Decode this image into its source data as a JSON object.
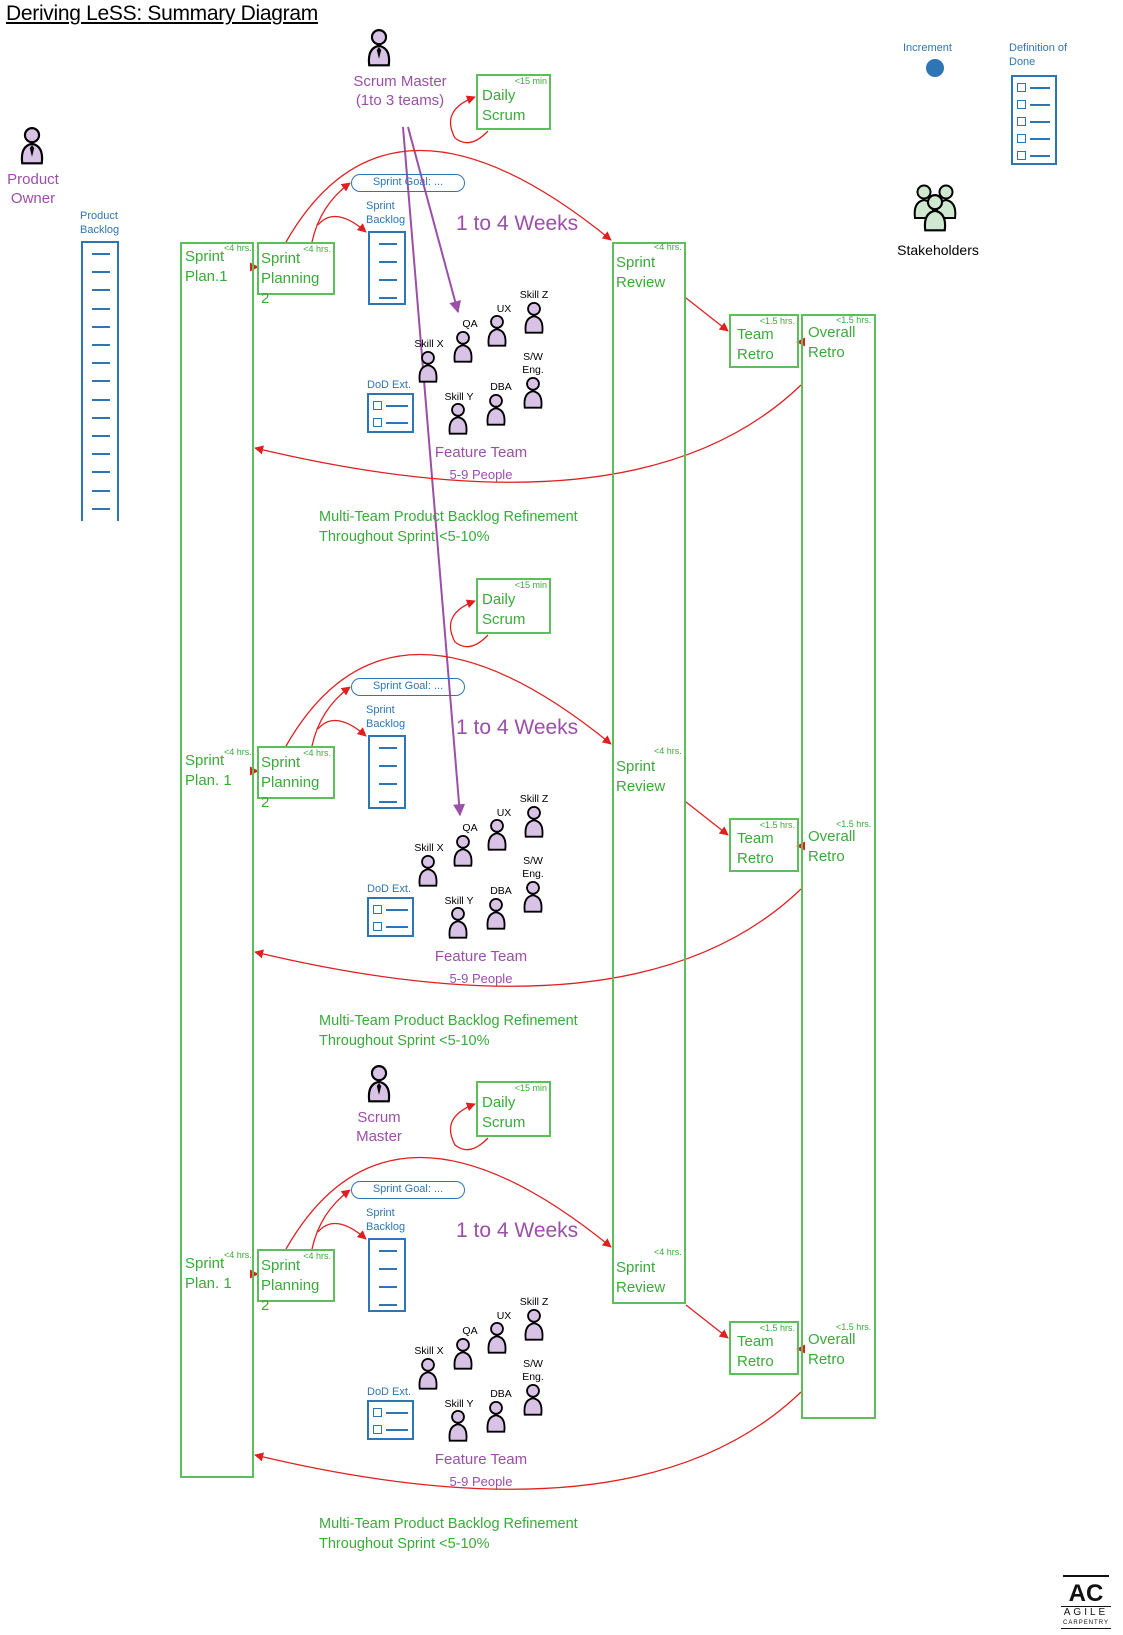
{
  "title": "Deriving LeSS: Summary Diagram",
  "roles": {
    "product_owner": "Product Owner",
    "scrum_master_top": "Scrum Master (1to 3 teams)",
    "scrum_master_bottom": "Scrum Master",
    "stakeholders": "Stakeholders"
  },
  "legend": {
    "increment": "Increment",
    "definition_of_done": "Definition of Done",
    "dod_items": 5
  },
  "product_backlog": {
    "label": "Product Backlog",
    "items": 15
  },
  "colors": {
    "event_green": "#3aaa3a",
    "artifact_blue": "#2e75b6",
    "role_purple": "#9b4fa8",
    "flow_red": "#e02020",
    "person_fill": "#d8c3e6",
    "stakeholder_fill": "#cfe8cf"
  },
  "shared_events": {
    "sprint_planning_1": {
      "duration": "<4 hrs."
    },
    "overall_retro": {
      "label": "Overall Retro",
      "duration": "<1.5 hrs."
    }
  },
  "teams": [
    {
      "sprint_plan_1_label": "Sprint Plan.1",
      "sprint_planning_2": {
        "label": "Sprint Planning 2",
        "duration": "<4 hrs."
      },
      "sprint_goal": "Sprint Goal: ...",
      "sprint_backlog": "Sprint Backlog",
      "daily_scrum": {
        "label": "Daily Scrum",
        "duration": "<15 min"
      },
      "duration": "1 to 4 Weeks",
      "sprint_review": {
        "label": "Sprint Review",
        "duration": "<4 hrs."
      },
      "team_retro": {
        "label": "Team Retro",
        "duration": "<1.5 hrs."
      },
      "overall_retro_label": "Overall Retro",
      "overall_retro_duration": "<1.5 hrs.",
      "dod_ext": "DoD Ext.",
      "feature_team": "Feature Team",
      "team_size": "5-9 People",
      "members": [
        "Skill X",
        "QA",
        "UX",
        "Skill Z",
        "Skill Y",
        "DBA",
        "S/W Eng."
      ],
      "refinement": "Multi-Team Product Backlog Refinement Throughout Sprint <5-10%"
    },
    {
      "sprint_plan_1_label": "Sprint Plan. 1",
      "sprint_planning_2": {
        "label": "Sprint Planning 2",
        "duration": "<4 hrs."
      },
      "sprint_goal": "Sprint Goal: ...",
      "sprint_backlog": "Sprint Backlog",
      "daily_scrum": {
        "label": "Daily Scrum",
        "duration": "<15 min"
      },
      "duration": "1 to 4 Weeks",
      "sprint_review": {
        "label": "Sprint Review",
        "duration": "<4 hrs."
      },
      "team_retro": {
        "label": "Team Retro",
        "duration": "<1.5 hrs."
      },
      "overall_retro_label": "Overall Retro",
      "overall_retro_duration": "<1.5 hrs.",
      "dod_ext": "DoD Ext.",
      "feature_team": "Feature Team",
      "team_size": "5-9 People",
      "members": [
        "Skill X",
        "QA",
        "UX",
        "Skill Z",
        "Skill Y",
        "DBA",
        "S/W Eng."
      ],
      "refinement": "Multi-Team Product Backlog Refinement Throughout Sprint <5-10%"
    },
    {
      "sprint_plan_1_label": "Sprint Plan. 1",
      "sprint_planning_2": {
        "label": "Sprint Planning 2",
        "duration": "<4 hrs."
      },
      "sprint_goal": "Sprint Goal: ...",
      "sprint_backlog": "Sprint Backlog",
      "daily_scrum": {
        "label": "Daily Scrum",
        "duration": "<15 min"
      },
      "duration": "1 to 4 Weeks",
      "sprint_review": {
        "label": "Sprint Review",
        "duration": "<4 hrs."
      },
      "team_retro": {
        "label": "Team Retro",
        "duration": "<1.5 hrs."
      },
      "overall_retro_label": "Overall Retro",
      "overall_retro_duration": "<1.5 hrs.",
      "dod_ext": "DoD Ext.",
      "feature_team": "Feature Team",
      "team_size": "5-9 People",
      "members": [
        "Skill X",
        "QA",
        "UX",
        "Skill Z",
        "Skill Y",
        "DBA",
        "S/W Eng."
      ],
      "refinement": "Multi-Team Product Backlog Refinement Throughout Sprint <5-10%"
    }
  ],
  "logo": {
    "mark": "AC",
    "line1": "AGILE",
    "line2": "CARPENTRY"
  }
}
